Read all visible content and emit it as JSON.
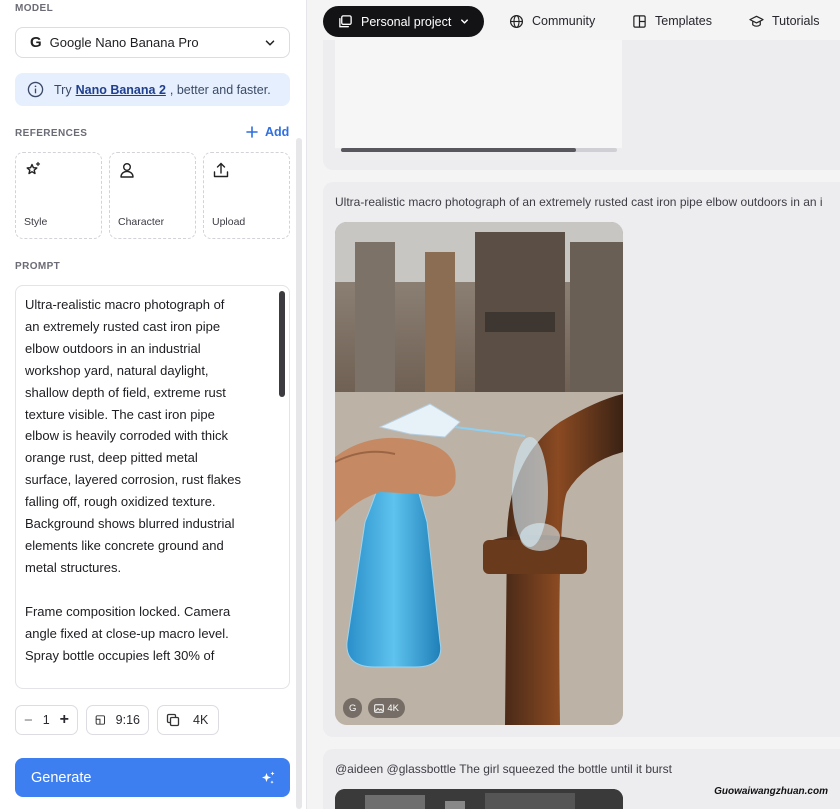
{
  "left_panel": {
    "model_label": "MODEL",
    "model_selected": "Google Nano Banana Pro",
    "model_logo": "G",
    "promo": {
      "prefix": "Try",
      "link": "Nano Banana 2",
      "suffix": ", better and faster."
    },
    "references_label": "REFERENCES",
    "add_label": "Add",
    "reference_cards": [
      {
        "label": "Style",
        "icon": "sparkle-star-icon"
      },
      {
        "label": "Character",
        "icon": "person-icon"
      },
      {
        "label": "Upload",
        "icon": "upload-icon"
      }
    ],
    "prompt_label": "PROMPT",
    "prompt_text": "Ultra-realistic macro photograph of\nan extremely rusted cast iron pipe\nelbow outdoors in an industrial\nworkshop yard, natural daylight,\nshallow depth of field, extreme rust\ntexture visible. The cast iron pipe\nelbow is heavily corroded with thick\norange rust, deep pitted metal\nsurface, layered corrosion, rust flakes\nfalling off, rough oxidized texture.\nBackground shows blurred industrial\nelements like concrete ground and\nmetal structures.\n\nFrame composition locked. Camera\nangle fixed at close-up macro level.\nSpray bottle occupies left 30% of",
    "quantity": "1",
    "minus_symbol": "−",
    "plus_symbol": "+",
    "aspect_ratio": "9:16",
    "resolution": "4K",
    "generate_label": "Generate"
  },
  "top_nav": {
    "items": [
      {
        "label": "Personal project",
        "icon": "layers-icon",
        "active": true
      },
      {
        "label": "Community",
        "icon": "globe-icon"
      },
      {
        "label": "Templates",
        "icon": "grid-icon"
      },
      {
        "label": "Tutorials",
        "icon": "graduation-cap-icon"
      }
    ]
  },
  "feed": {
    "top_card_progress": 0.85,
    "post": {
      "caption": "Ultra-realistic macro photograph of an extremely rusted cast iron pipe elbow outdoors in an i",
      "badge_model": "G",
      "badge_resolution": "4K"
    },
    "next_post_caption": "@aideen @glassbottle The girl squeezed the bottle until it burst"
  },
  "watermark": "Guowaiwangzhuan.com",
  "colors": {
    "accent": "#3d7ff0",
    "promo_bg": "#e6effd",
    "nav_active_bg": "#131316"
  }
}
